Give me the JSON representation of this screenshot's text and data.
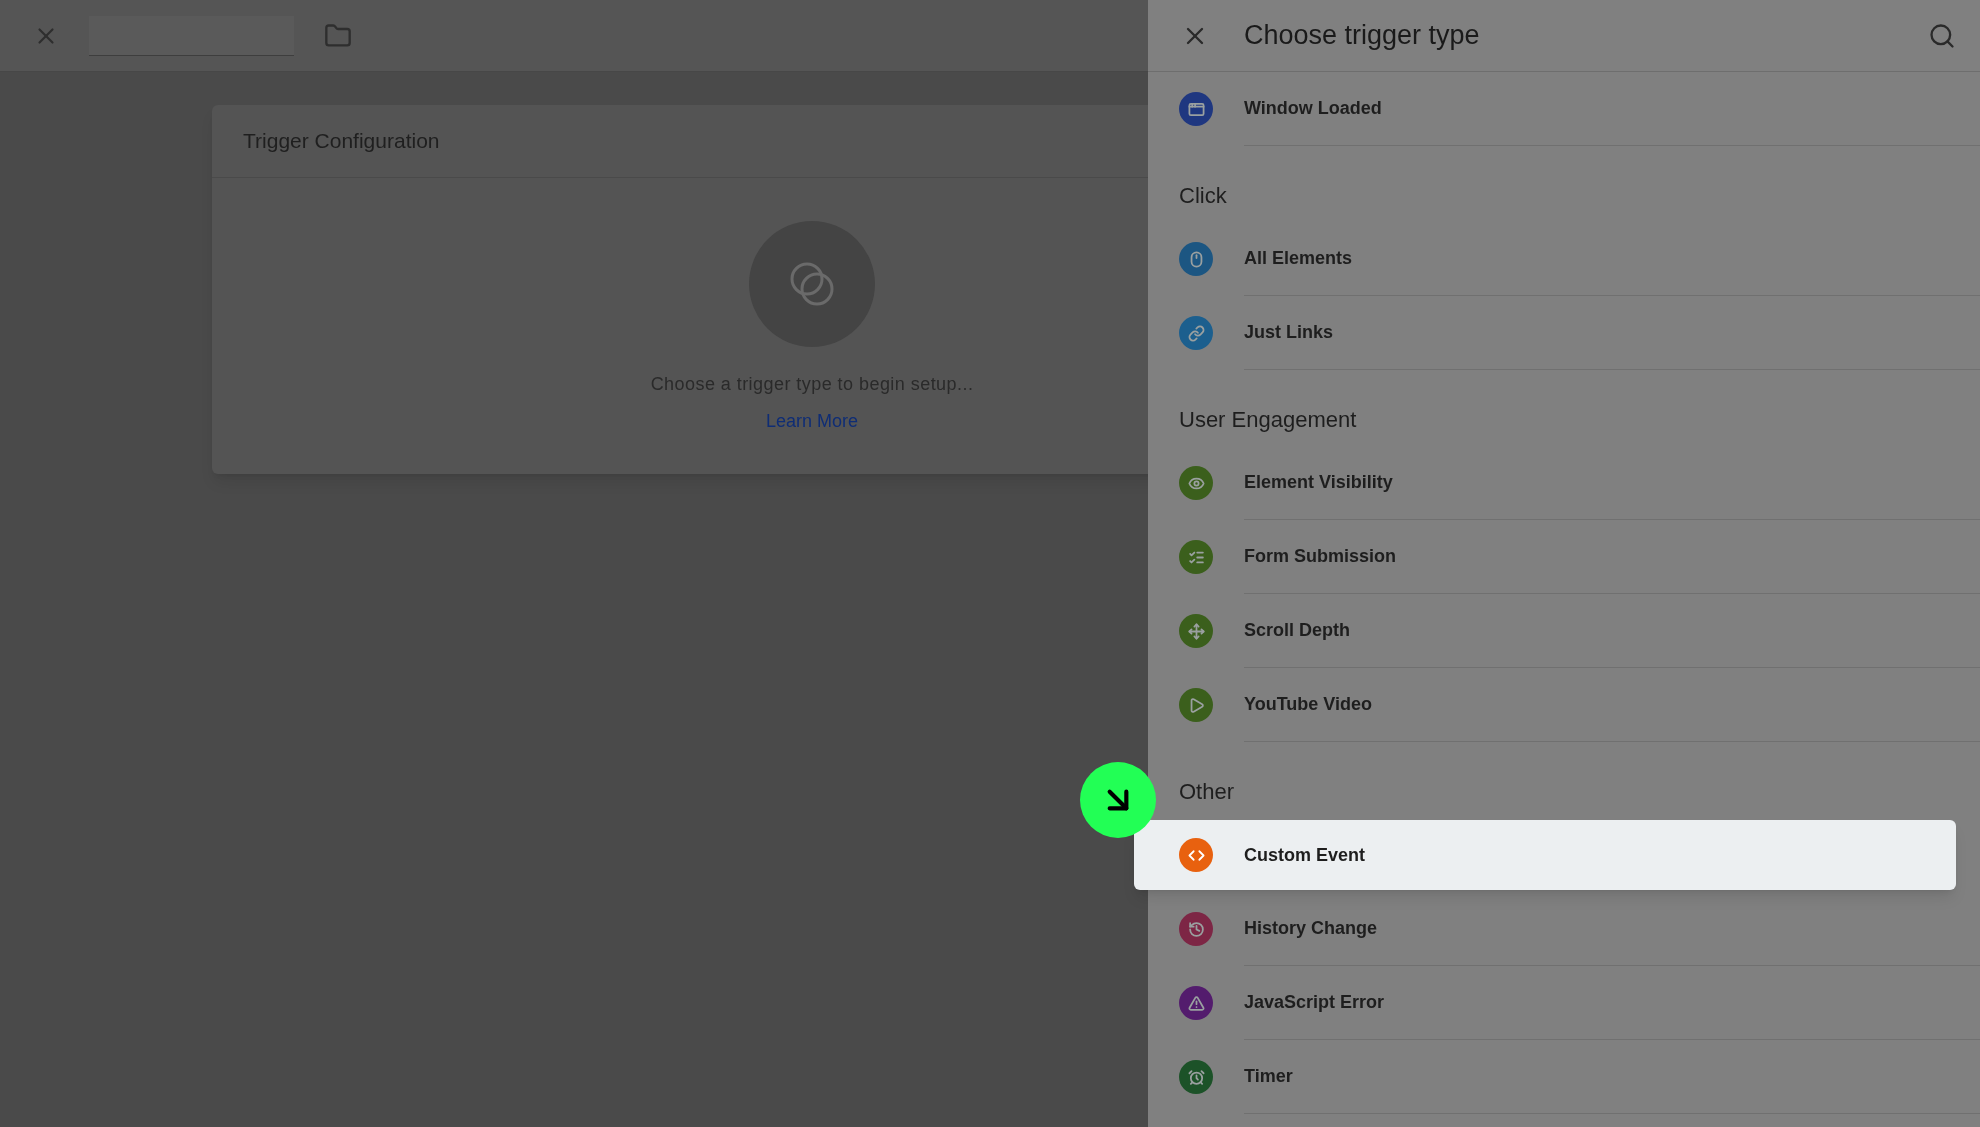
{
  "card": {
    "title": "Trigger Configuration",
    "message": "Choose a trigger type to begin setup...",
    "link": "Learn More"
  },
  "panel": {
    "title": "Choose trigger type",
    "sections": [
      {
        "items": [
          {
            "label": "Window Loaded",
            "color": "#1f3780",
            "selected": false
          }
        ]
      },
      {
        "heading": "Click",
        "items": [
          {
            "label": "All Elements",
            "color": "#1c5682",
            "selected": false
          },
          {
            "label": "Just Links",
            "color": "#1c5f8e",
            "selected": false
          }
        ]
      },
      {
        "heading": "User Engagement",
        "items": [
          {
            "label": "Element Visibility",
            "color": "#3b5f1c",
            "selected": false
          },
          {
            "label": "Form Submission",
            "color": "#3b5f1c",
            "selected": false
          },
          {
            "label": "Scroll Depth",
            "color": "#3b5f1c",
            "selected": false
          },
          {
            "label": "YouTube Video",
            "color": "#3b5f1c",
            "selected": false
          }
        ]
      },
      {
        "heading": "Other",
        "items": [
          {
            "label": "Custom Event",
            "color": "#e8610f",
            "selected": true
          },
          {
            "label": "History Change",
            "color": "#7d2645",
            "selected": false
          },
          {
            "label": "JavaScript Error",
            "color": "#531c6d",
            "selected": false
          },
          {
            "label": "Timer",
            "color": "#1c5228",
            "selected": false
          }
        ]
      }
    ]
  }
}
